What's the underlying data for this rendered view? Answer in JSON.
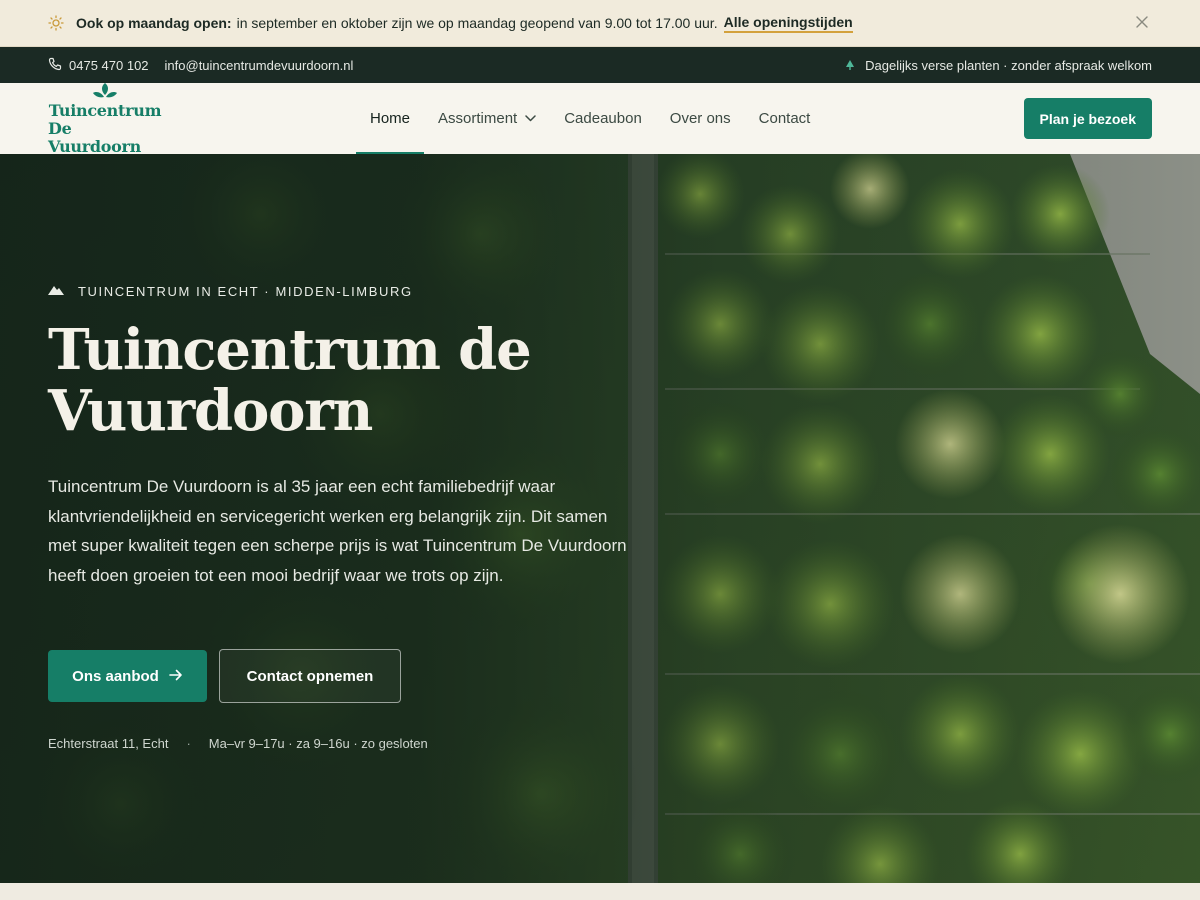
{
  "announcement": {
    "icon": "sun-icon",
    "bold": "Ook op maandag open:",
    "message": "in september en oktober zijn we op maandag geopend van 9.00 tot 17.00 uur.",
    "link": "Alle openingstijden",
    "accent_color": "#d3a13c"
  },
  "utility": {
    "phone": "0475 470 102",
    "email": "info@tuincentrumdevuurdoorn.nl",
    "tagline": "Dagelijks verse planten · zonder afspraak welkom"
  },
  "header": {
    "logo_line1": "Tuincentrum",
    "logo_line2": "De Vuurdoorn",
    "nav": [
      "Home",
      "Assortiment",
      "Cadeaubon",
      "Over ons",
      "Contact"
    ],
    "active": "Home",
    "cta": "Plan je bezoek",
    "brand_color": "#167e67"
  },
  "hero": {
    "eyebrow": "TUINCENTRUM IN ECHT · MIDDEN-LIMBURG",
    "title": "Tuincentrum de Vuurdoorn",
    "body": "Tuincentrum De Vuurdoorn is al 35 jaar een echt familiebedrijf waar klantvriendelijkheid en servicegericht werken erg belangrijk zijn. Dit samen met super kwaliteit tegen een scherpe prijs is wat Tuincentrum De Vuurdoorn heeft doen groeien tot een mooi bedrijf waar we trots op zijn.",
    "primary_button": "Ons aanbod",
    "secondary_button": "Contact opnemen",
    "address": "Echterstraat 11, Echt",
    "separator": "·",
    "hours": "Ma–vr 9–17u · za 9–16u · zo gesloten"
  }
}
